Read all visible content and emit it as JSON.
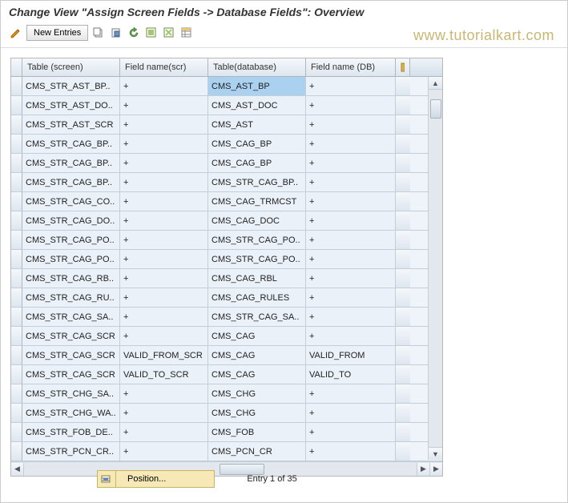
{
  "title": "Change View \"Assign Screen Fields -> Database Fields\": Overview",
  "toolbar": {
    "new_entries": "New Entries"
  },
  "watermark": "www.tutorialkart.com",
  "headers": {
    "col1": "Table (screen)",
    "col2": "Field name(scr)",
    "col3": "Table(database)",
    "col4": "Field name (DB)"
  },
  "rows": [
    {
      "c1": "CMS_STR_AST_BP..",
      "c2": "+",
      "c3": "CMS_AST_BP",
      "c4": "+",
      "hl": true
    },
    {
      "c1": "CMS_STR_AST_DO..",
      "c2": "+",
      "c3": "CMS_AST_DOC",
      "c4": "+"
    },
    {
      "c1": "CMS_STR_AST_SCR",
      "c2": "+",
      "c3": "CMS_AST",
      "c4": "+"
    },
    {
      "c1": "CMS_STR_CAG_BP..",
      "c2": "+",
      "c3": "CMS_CAG_BP",
      "c4": "+"
    },
    {
      "c1": "CMS_STR_CAG_BP..",
      "c2": "+",
      "c3": "CMS_CAG_BP",
      "c4": "+"
    },
    {
      "c1": "CMS_STR_CAG_BP..",
      "c2": "+",
      "c3": "CMS_STR_CAG_BP..",
      "c4": "+"
    },
    {
      "c1": "CMS_STR_CAG_CO..",
      "c2": "+",
      "c3": "CMS_CAG_TRMCST",
      "c4": "+"
    },
    {
      "c1": "CMS_STR_CAG_DO..",
      "c2": "+",
      "c3": "CMS_CAG_DOC",
      "c4": "+"
    },
    {
      "c1": "CMS_STR_CAG_PO..",
      "c2": "+",
      "c3": "CMS_STR_CAG_PO..",
      "c4": "+"
    },
    {
      "c1": "CMS_STR_CAG_PO..",
      "c2": "+",
      "c3": "CMS_STR_CAG_PO..",
      "c4": "+"
    },
    {
      "c1": "CMS_STR_CAG_RB..",
      "c2": "+",
      "c3": "CMS_CAG_RBL",
      "c4": "+"
    },
    {
      "c1": "CMS_STR_CAG_RU..",
      "c2": "+",
      "c3": "CMS_CAG_RULES",
      "c4": "+"
    },
    {
      "c1": "CMS_STR_CAG_SA..",
      "c2": "+",
      "c3": "CMS_STR_CAG_SA..",
      "c4": "+"
    },
    {
      "c1": "CMS_STR_CAG_SCR",
      "c2": "+",
      "c3": "CMS_CAG",
      "c4": "+"
    },
    {
      "c1": "CMS_STR_CAG_SCR",
      "c2": "VALID_FROM_SCR",
      "c3": "CMS_CAG",
      "c4": "VALID_FROM"
    },
    {
      "c1": "CMS_STR_CAG_SCR",
      "c2": "VALID_TO_SCR",
      "c3": "CMS_CAG",
      "c4": "VALID_TO"
    },
    {
      "c1": "CMS_STR_CHG_SA..",
      "c2": "+",
      "c3": "CMS_CHG",
      "c4": "+"
    },
    {
      "c1": "CMS_STR_CHG_WA..",
      "c2": "+",
      "c3": "CMS_CHG",
      "c4": "+"
    },
    {
      "c1": "CMS_STR_FOB_DE..",
      "c2": "+",
      "c3": "CMS_FOB",
      "c4": "+"
    },
    {
      "c1": "CMS_STR_PCN_CR..",
      "c2": "+",
      "c3": "CMS_PCN_CR",
      "c4": "+"
    }
  ],
  "footer": {
    "position": "Position...",
    "entry": "Entry 1 of 35"
  }
}
